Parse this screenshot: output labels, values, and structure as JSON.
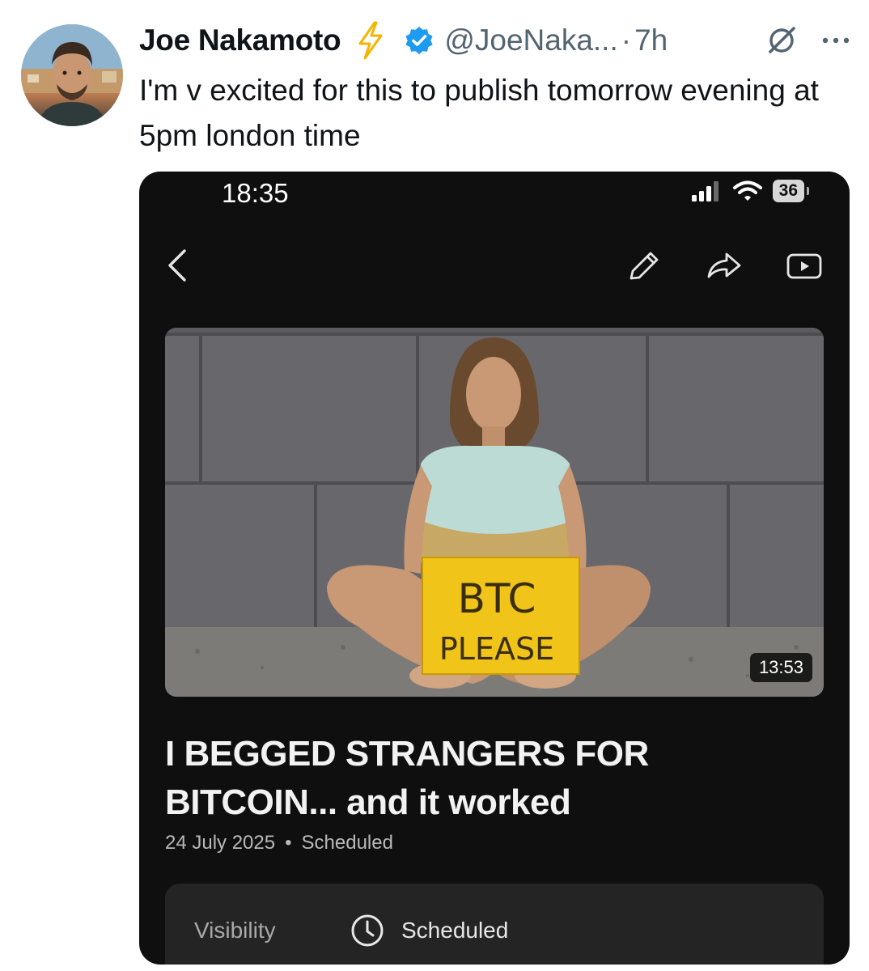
{
  "tweet": {
    "author_name": "Joe Nakamoto",
    "handle": "@JoeNaka...",
    "separator": "·",
    "time_ago": "7h",
    "text": "I'm v excited for this to publish tomorrow evening at 5pm london time",
    "colors": {
      "bolt": "#f5b400",
      "verified": "#1d9bf0",
      "secondary_text": "#536471"
    }
  },
  "phone": {
    "status_time": "18:35",
    "battery": "36",
    "video": {
      "sign_text_line1": "BTC",
      "sign_text_line2": "PLEASE",
      "duration": "13:53",
      "title": "I BEGGED STRANGERS FOR BITCOIN... and it worked",
      "date": "24 July 2025",
      "meta_separator": "•",
      "status": "Scheduled"
    },
    "visibility": {
      "label": "Visibility",
      "value": "Scheduled"
    }
  }
}
